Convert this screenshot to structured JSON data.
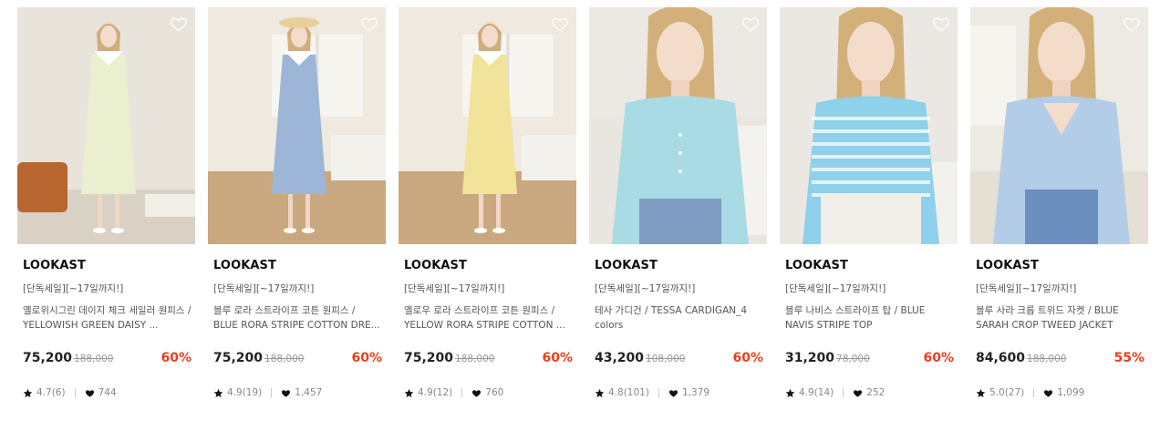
{
  "products": [
    {
      "brand": "LOOKAST",
      "promo": "[단독세일][~17일까지!]",
      "name": "옐로위시그린 데이지 체크 세일러 원피스 / YELLOWISH GREEN DAISY ...",
      "price": "75,200",
      "original_price": "188,000",
      "discount": "60%",
      "rating": "4.7(6)",
      "likes": "744",
      "image_desc": "yellowish green sailor collar dress",
      "dress_color": "#e9efcf",
      "bg_color": "#e8e4dc"
    },
    {
      "brand": "LOOKAST",
      "promo": "[단독세일][~17일까지!]",
      "name": "블루 로라 스트라이프 코튼 원피스 / BLUE RORA STRIPE COTTON DRE...",
      "price": "75,200",
      "original_price": "188,000",
      "discount": "60%",
      "rating": "4.9(19)",
      "likes": "1,457",
      "image_desc": "blue stripe cotton dress",
      "dress_color": "#9db6d8",
      "bg_color": "#efe9df"
    },
    {
      "brand": "LOOKAST",
      "promo": "[단독세일][~17일까지!]",
      "name": "옐로우 로라 스트라이프 코튼 원피스 / YELLOW RORA STRIPE COTTON ...",
      "price": "75,200",
      "original_price": "188,000",
      "discount": "60%",
      "rating": "4.9(12)",
      "likes": "760",
      "image_desc": "yellow stripe cotton dress",
      "dress_color": "#f2e39a",
      "bg_color": "#efe9df"
    },
    {
      "brand": "LOOKAST",
      "promo": "[단독세일][~17일까지!]",
      "name": "테사 가디건 / TESSA CARDIGAN_4 colors",
      "price": "43,200",
      "original_price": "108,000",
      "discount": "60%",
      "rating": "4.8(101)",
      "likes": "1,379",
      "image_desc": "light blue cardigan",
      "dress_color": "#a8dbe3",
      "bg_color": "#ece9e4"
    },
    {
      "brand": "LOOKAST",
      "promo": "[단독세일][~17일까지!]",
      "name": "블루 나비스 스트라이프 탑 / BLUE NAVIS STRIPE TOP",
      "price": "31,200",
      "original_price": "78,000",
      "discount": "60%",
      "rating": "4.9(14)",
      "likes": "252",
      "image_desc": "blue stripe knit top",
      "dress_color": "#8fd0ea",
      "bg_color": "#ebe8e4"
    },
    {
      "brand": "LOOKAST",
      "promo": "[단독세일][~17일까지!]",
      "name": "블루 사라 크롭 트위드 자켓 / BLUE SARAH CROP TWEED JACKET",
      "price": "84,600",
      "original_price": "188,000",
      "discount": "55%",
      "rating": "5.0(27)",
      "likes": "1,099",
      "image_desc": "blue crop tweed jacket",
      "dress_color": "#b3cde8",
      "bg_color": "#ede9e3"
    }
  ],
  "icons": {
    "wishlist": "heart-outline-icon",
    "rating": "star-icon",
    "likes": "heart-icon"
  },
  "colors": {
    "discount": "#e8401c",
    "text": "#222222",
    "muted": "#888888"
  }
}
